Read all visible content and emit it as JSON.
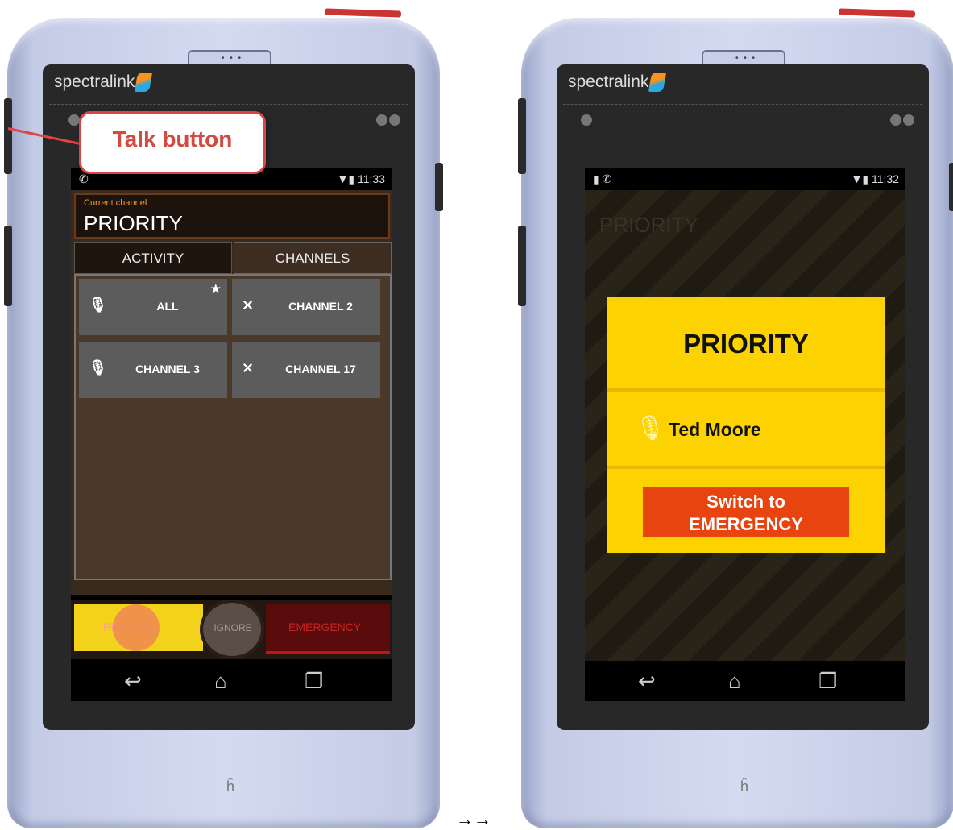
{
  "left_phone": {
    "brand": "spectralink",
    "speaker_dots": "• • •",
    "status_time": "11:33",
    "status_icons": "▼▮",
    "current_channel_label": "Current channel",
    "current_channel": "PRIORITY",
    "tabs": [
      {
        "label": "ACTIVITY"
      },
      {
        "label": "CHANNELS"
      }
    ],
    "channels": [
      {
        "label": "ALL",
        "starred": true
      },
      {
        "label": "CHANNEL 2",
        "muted": true
      },
      {
        "label": "CHANNEL 3",
        "muted": false
      },
      {
        "label": "CHANNEL 17",
        "muted": true
      }
    ],
    "priority_btn": "PRIORITY",
    "ignore_btn": "IGNORE",
    "emergency_btn": "EMERGENCY",
    "callout": "Talk button",
    "bottom_logo": "ĥ"
  },
  "right_phone": {
    "brand": "spectralink",
    "speaker_dots": "• • •",
    "status_time": "11:32",
    "status_icons": "▼▮",
    "bg_channel": "PRIORITY",
    "dialog_title": "PRIORITY",
    "caller_name": "Ted Moore",
    "switch_btn_line1": "Switch to",
    "switch_btn_line2": "EMERGENCY",
    "bottom_logo": "ĥ"
  },
  "arrows": "→→",
  "colors": {
    "priority_yellow": "#fcd200",
    "emergency_red": "#e84410",
    "accent_orange": "#f29a2e"
  }
}
